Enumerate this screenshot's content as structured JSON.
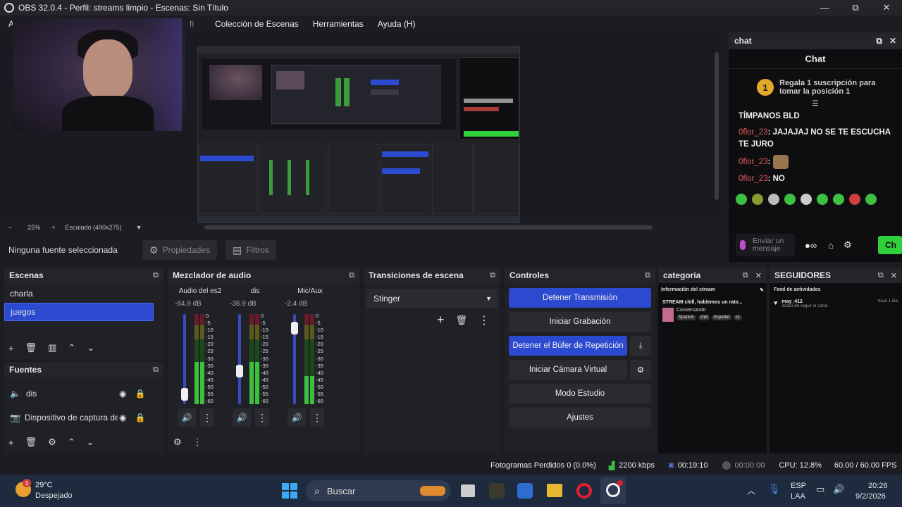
{
  "window": {
    "title": "OBS 32.0.4 - Perfil: streams limpio - Escenas: Sin Título",
    "minimize": "—",
    "maximize": "⧉",
    "close": "✕"
  },
  "menu": {
    "items": [
      "Colección de Escenas",
      "Herramientas",
      "Ayuda (H)"
    ],
    "partial_left": "A",
    "partial_fi": "fi"
  },
  "zoom": {
    "minus": "−",
    "level": "25%",
    "plus": "+",
    "scaled": "Escalado (490x275)"
  },
  "sourcebar": {
    "no_source": "Ninguna fuente seleccionada",
    "properties": "Propiedades",
    "filters": "Filtros"
  },
  "chat": {
    "dock_title": "chat",
    "header": "Chat",
    "promo_rank": "1",
    "promo_text": "Regala 1 suscripción para tomar la posición 1",
    "messages": [
      {
        "user": "",
        "text": "TÍMPANOS BLD"
      },
      {
        "user": "0flor_23",
        "text": ": JAJAJAJ NO SE TE ESCUCHA TE JURO"
      },
      {
        "user": "0flor_23",
        "text": ":"
      },
      {
        "user": "0flor_23",
        "text": ": NO"
      }
    ],
    "input_placeholder": "Enviar un mensaje",
    "send_label": "Ch"
  },
  "scenes": {
    "title": "Escenas",
    "items": [
      "charla",
      "juegos"
    ],
    "selected": 1
  },
  "sources": {
    "title": "Fuentes",
    "items": [
      "dis",
      "Dispositivo de captura de"
    ]
  },
  "mixer": {
    "title": "Mezclador de audio",
    "channels": [
      {
        "name": "Audio del es2",
        "db": "-64.9 dB",
        "level": 0.05
      },
      {
        "name": "dis",
        "db": "-36.9 dB",
        "level": 0.35
      },
      {
        "name": "Mic/Aux",
        "db": "-2.4 dB",
        "level": 0.9
      }
    ],
    "scale": [
      "0",
      "-5",
      "-10",
      "-15",
      "-20",
      "-25",
      "-30",
      "-35",
      "-40",
      "-45",
      "-50",
      "-55",
      "-60"
    ]
  },
  "transitions": {
    "title": "Transiciones de escena",
    "selected": "Stinger"
  },
  "controls": {
    "title": "Controles",
    "stop_stream": "Detener Transmisión",
    "start_recording": "Iniciar Grabación",
    "stop_replay": "Detener el Búfer de Repetición",
    "start_vcam": "Iniciar Cámara Virtual",
    "studio_mode": "Modo Estudio",
    "settings": "Ajustes"
  },
  "categoria": {
    "title": "categoria",
    "info_header": "Información del stream",
    "stream_title": "STREAM chill, hablemos un rato...",
    "category": "Conversando",
    "tags": [
      "Spanish",
      "chill",
      "Español",
      "x1"
    ]
  },
  "seguidores": {
    "title": "SEGUIDORES",
    "feed_header": "Feed de actividades",
    "follower": "may_412",
    "follow_text": "acaba de seguir el canal",
    "time": "hace 1 día"
  },
  "status": {
    "dropped_frames": "Fotogramas Perdidos 0 (0.0%)",
    "bitrate": "2200 kbps",
    "stream_time": "00:19:10",
    "rec_time": "00:00:00",
    "cpu": "CPU: 12.8%",
    "fps": "60.00 / 60.00 FPS"
  },
  "taskbar": {
    "temp": "29°C",
    "weather": "Despejado",
    "weather_badge": "1",
    "search": "Buscar",
    "lang1": "ESP",
    "lang2": "LAA",
    "time": "20:26",
    "date": "9/2/2026"
  },
  "colors": {
    "accent": "#2c4ad0",
    "chat_green": "#2fd03c",
    "username_red": "#e35a5a"
  }
}
